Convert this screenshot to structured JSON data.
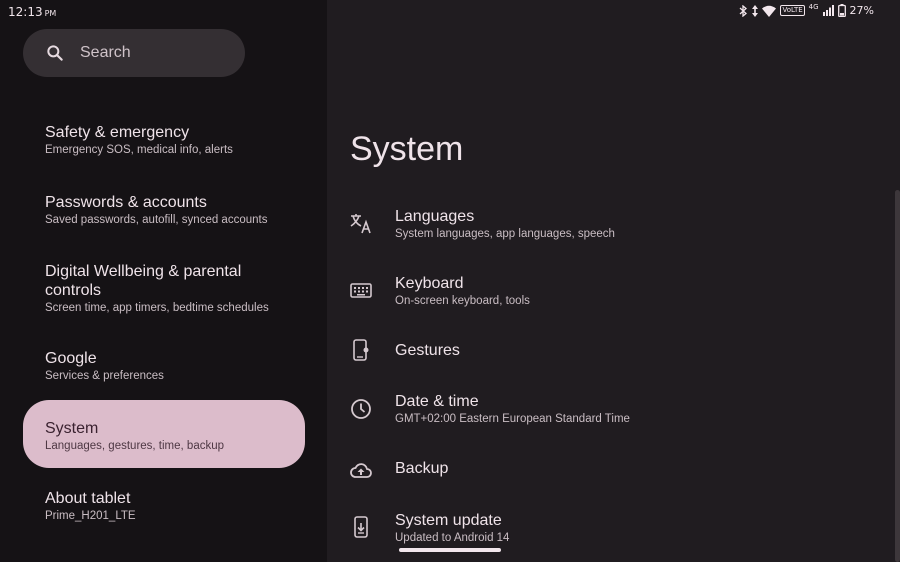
{
  "status": {
    "time": "12:13",
    "ampm": "PM",
    "volte": "VoLTE",
    "network": "4G",
    "battery": "27%"
  },
  "search": {
    "placeholder": "Search"
  },
  "sidebar": {
    "items": [
      {
        "title": "Safety & emergency",
        "subtitle": "Emergency SOS, medical info, alerts"
      },
      {
        "title": "Passwords & accounts",
        "subtitle": "Saved passwords, autofill, synced accounts"
      },
      {
        "title": "Digital Wellbeing & parental controls",
        "subtitle": "Screen time, app timers, bedtime schedules"
      },
      {
        "title": "Google",
        "subtitle": "Services & preferences"
      },
      {
        "title": "System",
        "subtitle": "Languages, gestures, time, backup"
      },
      {
        "title": "About tablet",
        "subtitle": "Prime_H201_LTE"
      }
    ]
  },
  "main": {
    "title": "System",
    "items": [
      {
        "title": "Languages",
        "subtitle": "System languages, app languages, speech",
        "icon": "translate-icon"
      },
      {
        "title": "Keyboard",
        "subtitle": "On-screen keyboard, tools",
        "icon": "keyboard-icon"
      },
      {
        "title": "Gestures",
        "subtitle": "",
        "icon": "gestures-icon"
      },
      {
        "title": "Date & time",
        "subtitle": "GMT+02:00 Eastern European Standard Time",
        "icon": "clock-icon"
      },
      {
        "title": "Backup",
        "subtitle": "",
        "icon": "cloud-upload-icon"
      },
      {
        "title": "System update",
        "subtitle": "Updated to Android 14",
        "icon": "system-update-icon"
      }
    ]
  },
  "colors": {
    "left_bg": "#151215",
    "right_bg": "#201c20",
    "selected_bg": "#dcbccb",
    "search_bg": "#342f33"
  }
}
